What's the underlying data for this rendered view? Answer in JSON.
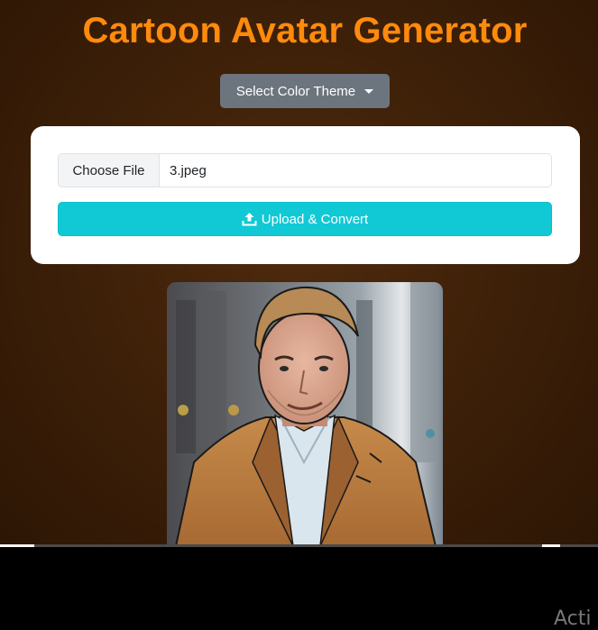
{
  "app": {
    "title": "Cartoon Avatar Generator"
  },
  "theme_dropdown": {
    "label": "Select Color Theme"
  },
  "upload_form": {
    "choose_file_label": "Choose File",
    "file_name": "3.jpeg",
    "upload_label": "Upload & Convert",
    "upload_icon": "upload-icon"
  },
  "result": {
    "image_name": "avatar-result-image"
  },
  "os": {
    "watermark": "Acti"
  },
  "colors": {
    "title": "#ff8a0c",
    "theme_button": "#6c757d",
    "upload_button": "#11c9d5",
    "background": "#3c1f08"
  }
}
